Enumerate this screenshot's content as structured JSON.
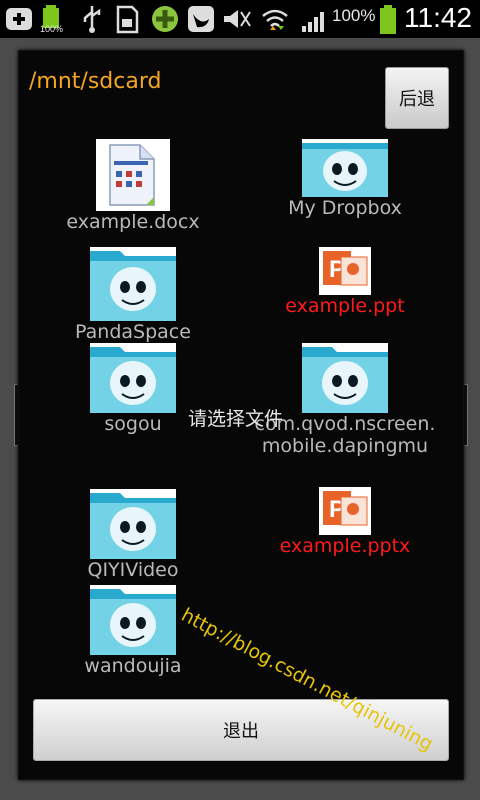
{
  "status_bar": {
    "battery_small_label": "100%",
    "signal_percent": "100%",
    "time": "11:42",
    "icons": [
      "add-icon",
      "battery-charging-icon",
      "usb-icon",
      "sd-card-icon",
      "game-icon",
      "bird-icon",
      "sound-off-icon",
      "wifi-icon",
      "signal-icon",
      "battery-icon"
    ]
  },
  "background": {
    "label": "请选择文件"
  },
  "dialog": {
    "path": "/mnt/sdcard",
    "back_label": "后退",
    "exit_label": "退出",
    "files": [
      {
        "name": "example.docx",
        "type": "document"
      },
      {
        "name": "My Dropbox",
        "type": "folder"
      },
      {
        "name": "PandaSpace",
        "type": "folder"
      },
      {
        "name": "example.ppt",
        "type": "powerpoint"
      },
      {
        "name": "sogou",
        "type": "folder"
      },
      {
        "name": "com.qvod.nscreen.",
        "name2": "mobile.dapingmu",
        "type": "folder"
      },
      {
        "name": "QIYIVideo",
        "type": "folder"
      },
      {
        "name": "example.pptx",
        "type": "powerpoint"
      },
      {
        "name": "wandoujia",
        "type": "folder"
      }
    ]
  },
  "watermark": "http://blog.csdn.net/qinjuning",
  "colors": {
    "path_color": "#f5a623",
    "file_name_gray": "#b9b9b9",
    "file_name_red": "#ff1a1a",
    "watermark": "#e6c40a"
  }
}
